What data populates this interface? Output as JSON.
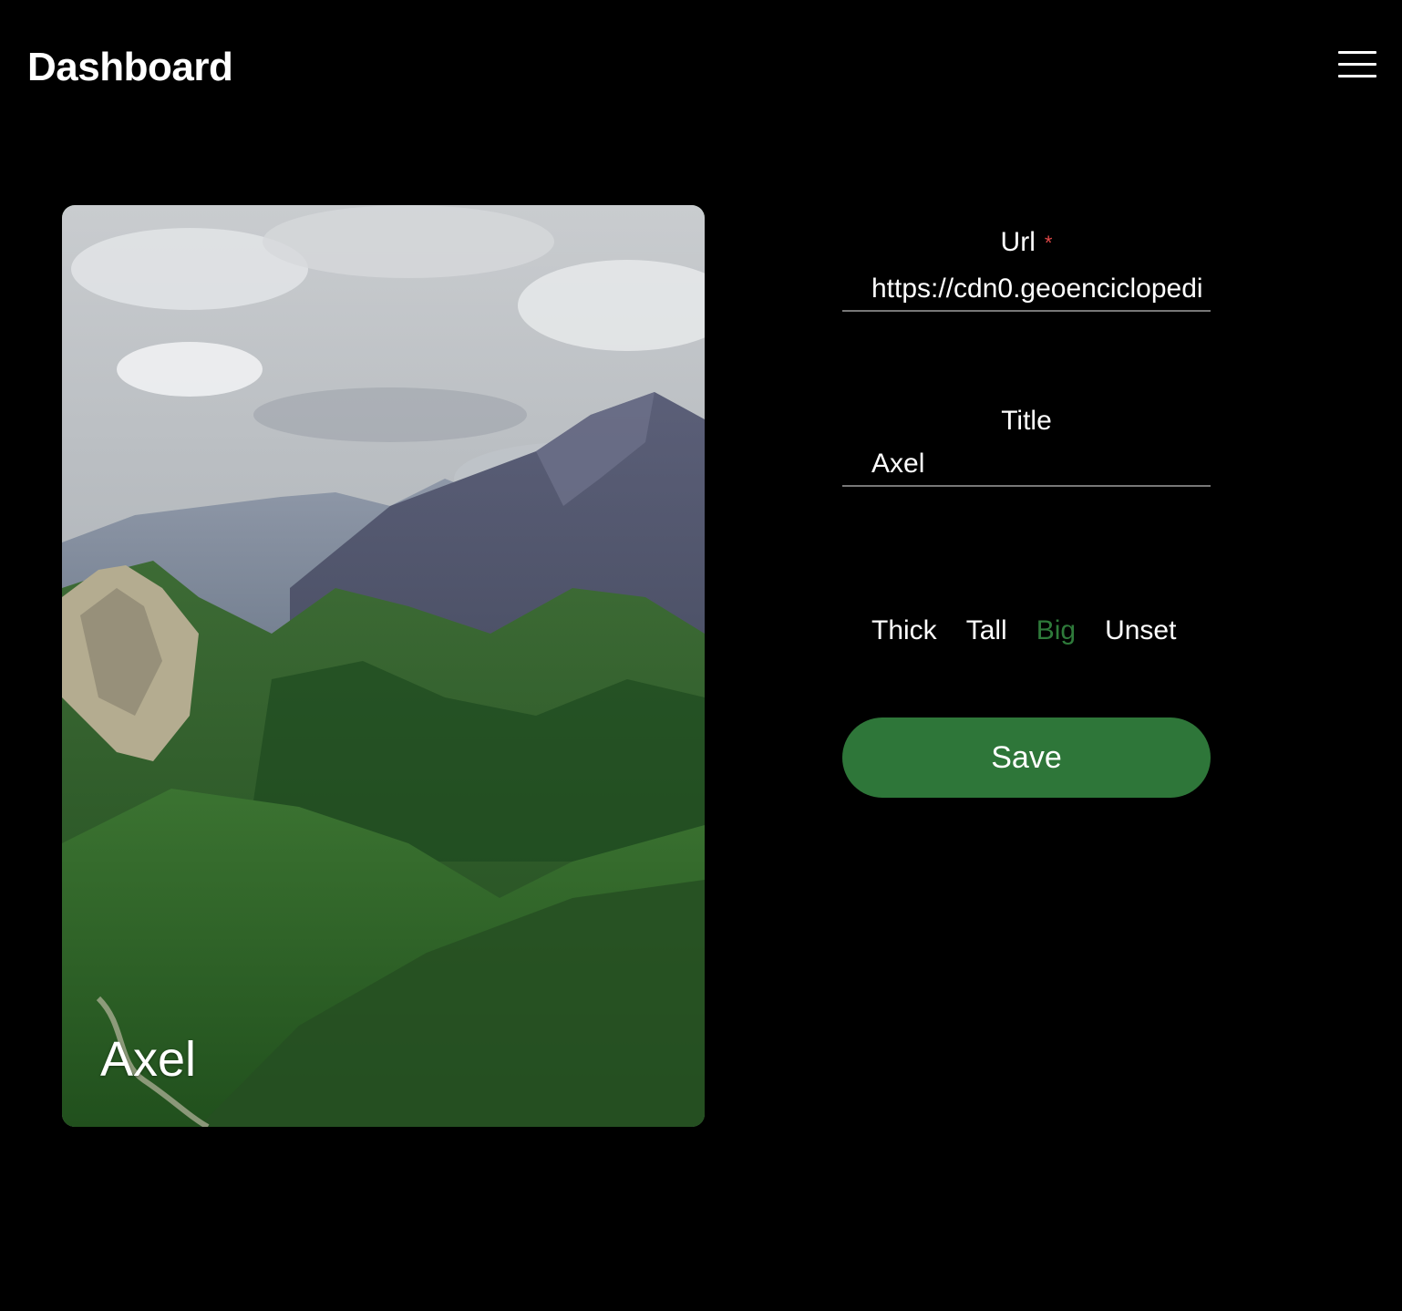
{
  "header": {
    "title": "Dashboard",
    "menu_icon": "hamburger-menu-icon"
  },
  "preview": {
    "caption": "Axel",
    "image_subject": "mountain valley landscape"
  },
  "form": {
    "url": {
      "label": "Url",
      "required_mark": "*",
      "value": "https://cdn0.geoenciclopedi"
    },
    "title": {
      "label": "Title",
      "value": "Axel"
    },
    "size_options": [
      "Thick",
      "Tall",
      "Big",
      "Unset"
    ],
    "selected_size": "Big",
    "save_label": "Save"
  },
  "colors": {
    "background": "#000000",
    "accent": "#2e7639",
    "selected_option": "#2e7a3a",
    "required": "#e04848",
    "text": "#ffffff"
  }
}
